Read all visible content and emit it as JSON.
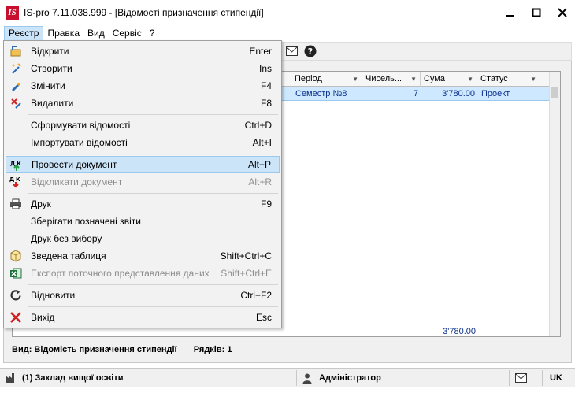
{
  "window": {
    "logo": "IS",
    "title": "IS-pro 7.11.038.999 - [Відомості призначення стипендії]"
  },
  "menubar": [
    "Реєстр",
    "Правка",
    "Вид",
    "Сервіс",
    "?"
  ],
  "grid": {
    "columns": [
      "Період",
      "Чисель...",
      "Сума",
      "Статус"
    ],
    "row": {
      "period": "Семестр  №8",
      "count": "7",
      "sum": "3'780.00",
      "status": "Проект"
    },
    "total_sum": "3'780.00"
  },
  "infobar": {
    "view": "Вид: Відомість призначення стипендії",
    "rows": "Рядків: 1"
  },
  "statusbar": {
    "org": "(1) Заклад вищої освіти",
    "user": "Адміністратор",
    "lang": "UK"
  },
  "dropdown": [
    {
      "icon": "open-icon",
      "label": "Відкрити",
      "shortcut": "Enter"
    },
    {
      "icon": "create-icon",
      "label": "Створити",
      "shortcut": "Ins"
    },
    {
      "icon": "edit-icon",
      "label": "Змінити",
      "shortcut": "F4"
    },
    {
      "icon": "delete-icon",
      "label": "Видалити",
      "shortcut": "F8"
    },
    {
      "icon": "",
      "label": "Сформувати відомості",
      "shortcut": "Ctrl+D"
    },
    {
      "icon": "",
      "label": "Імпортувати відомості",
      "shortcut": "Alt+I"
    },
    {
      "icon": "post-document-icon",
      "label": "Провести документ",
      "shortcut": "Alt+P"
    },
    {
      "icon": "unpost-document-icon",
      "label": "Відкликати документ",
      "shortcut": "Alt+R"
    },
    {
      "icon": "printer-icon",
      "label": "Друк",
      "shortcut": "F9"
    },
    {
      "icon": "",
      "label": "Зберігати позначені звіти",
      "shortcut": ""
    },
    {
      "icon": "",
      "label": "Друк без вибору",
      "shortcut": ""
    },
    {
      "icon": "pivot-table-icon",
      "label": "Зведена таблиця",
      "shortcut": "Shift+Ctrl+C"
    },
    {
      "icon": "excel-icon",
      "label": "Експорт поточного представлення даних",
      "shortcut": "Shift+Ctrl+E"
    },
    {
      "icon": "refresh-icon",
      "label": "Відновити",
      "shortcut": "Ctrl+F2"
    },
    {
      "icon": "exit-icon",
      "label": "Вихід",
      "shortcut": "Esc"
    }
  ]
}
